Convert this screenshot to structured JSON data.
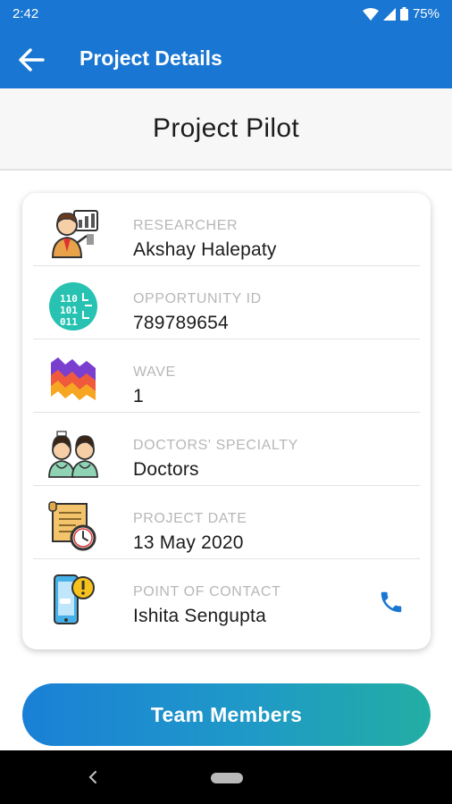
{
  "status_bar": {
    "time": "2:42",
    "battery": "75%"
  },
  "app_bar": {
    "title": "Project Details"
  },
  "project": {
    "name": "Project Pilot"
  },
  "details": [
    {
      "label": "RESEARCHER",
      "value": "Akshay Halepaty",
      "icon": "researcher-icon"
    },
    {
      "label": "OPPORTUNITY ID",
      "value": "789789654",
      "icon": "binary-code-icon"
    },
    {
      "label": "WAVE",
      "value": "1",
      "icon": "wave-chart-icon"
    },
    {
      "label": "DOCTORS' SPECIALTY",
      "value": "Doctors",
      "icon": "doctors-icon"
    },
    {
      "label": "PROJECT DATE",
      "value": "13 May 2020",
      "icon": "scroll-clock-icon"
    },
    {
      "label": "POINT OF CONTACT",
      "value": "Ishita Sengupta",
      "icon": "phone-alert-icon"
    }
  ],
  "team_button": {
    "label": "Team Members"
  },
  "colors": {
    "primary": "#1976d2",
    "gradient_start": "#1a80d6",
    "gradient_end": "#22aea3"
  }
}
